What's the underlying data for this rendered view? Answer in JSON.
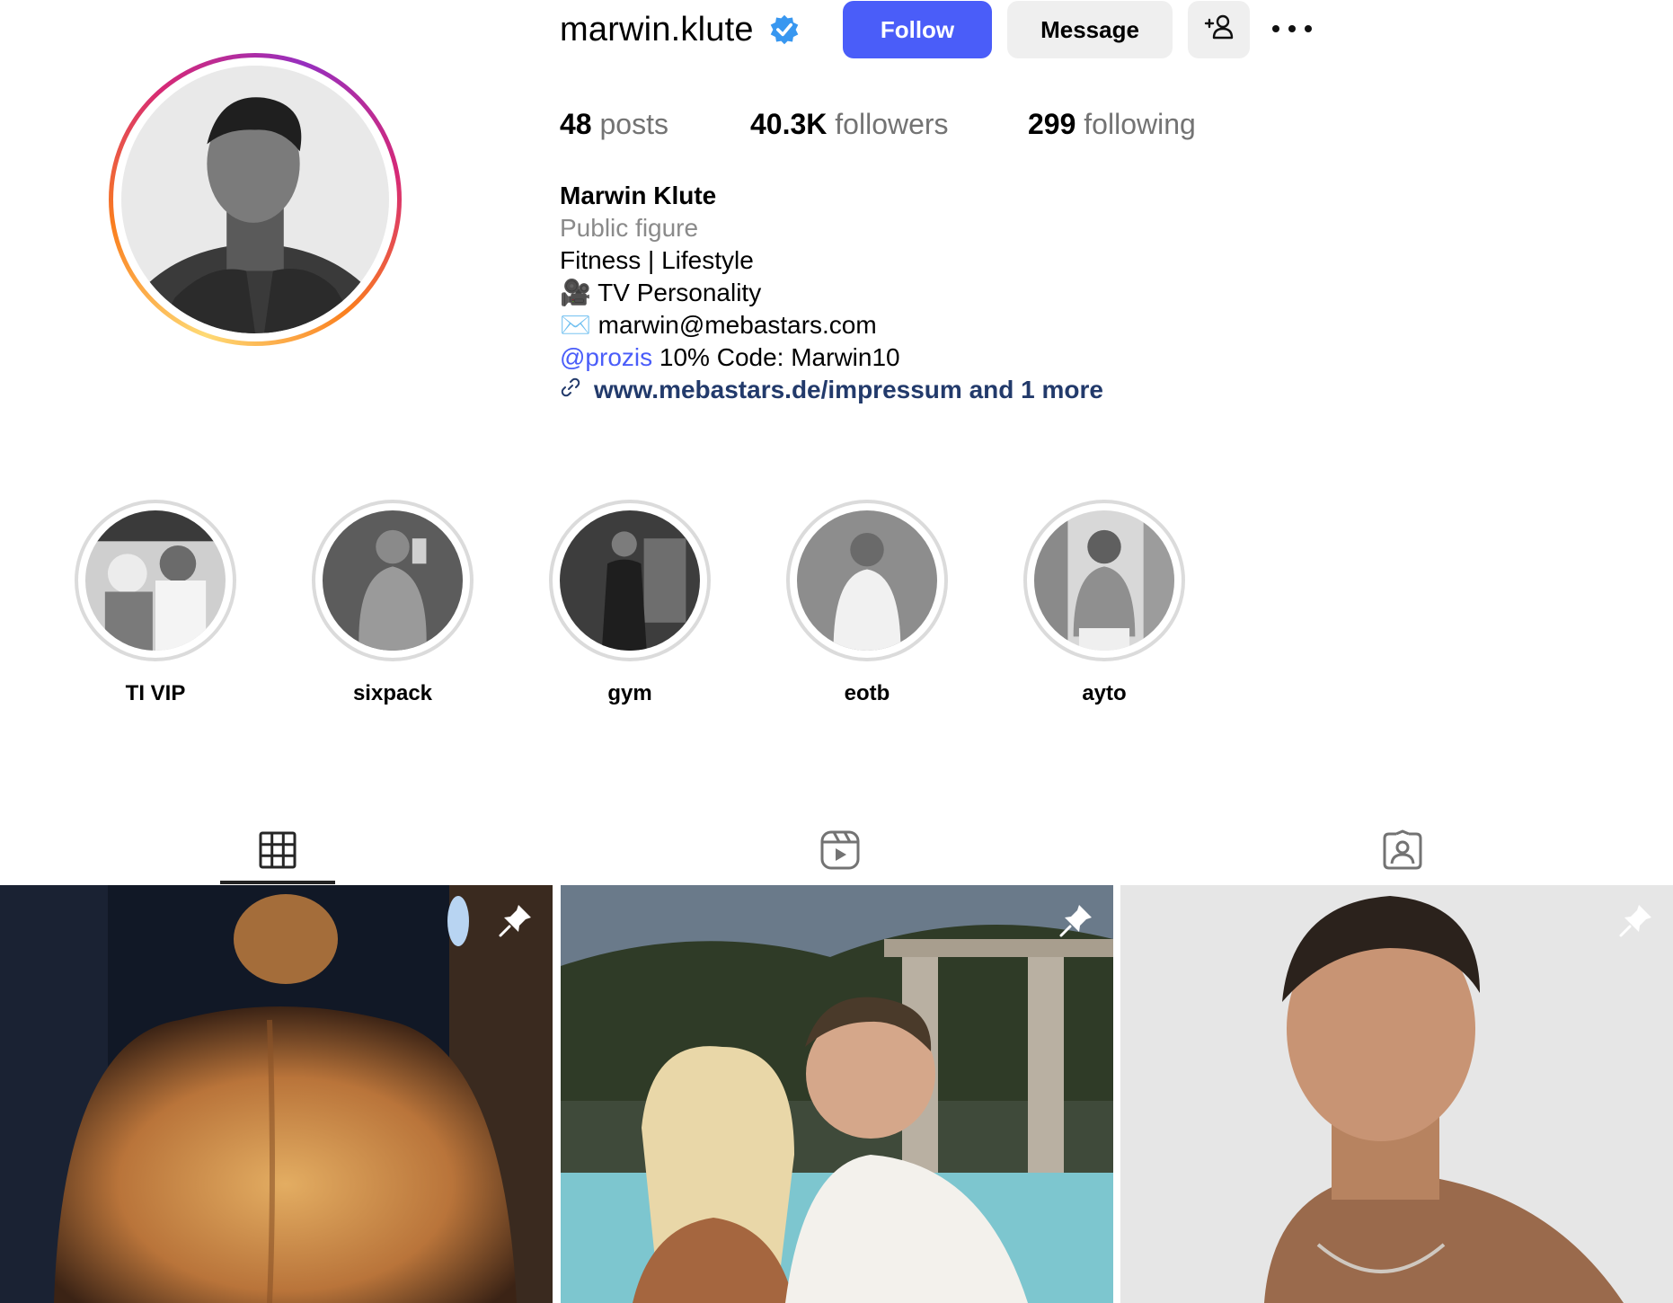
{
  "profile": {
    "username": "marwin.klute",
    "verified": true,
    "follow_label": "Follow",
    "message_label": "Message",
    "suggest_icon": "person-add-icon",
    "more_icon": "more-horizontal-icon"
  },
  "stats": {
    "posts_count": "48",
    "posts_label": "posts",
    "followers_count": "40.3K",
    "followers_label": "followers",
    "following_count": "299",
    "following_label": "following"
  },
  "bio": {
    "full_name": "Marwin Klute",
    "category": "Public figure",
    "line1": "Fitness | Lifestyle",
    "line2": "🎥 TV Personality",
    "line3": "✉️ marwin@mebastars.com",
    "mention": "@prozis",
    "mention_rest": " 10% Code: Marwin10",
    "link": "www.mebastars.de/impressum and 1 more"
  },
  "highlights": [
    {
      "label": "TI VIP"
    },
    {
      "label": "sixpack"
    },
    {
      "label": "gym"
    },
    {
      "label": "eotb"
    },
    {
      "label": "ayto"
    }
  ],
  "tabs": [
    {
      "icon": "grid-icon",
      "active": true
    },
    {
      "icon": "reels-icon",
      "active": false
    },
    {
      "icon": "tagged-icon",
      "active": false
    }
  ],
  "posts": [
    {
      "pinned": true
    },
    {
      "pinned": true
    },
    {
      "pinned": true
    }
  ],
  "colors": {
    "accent": "#4a5df9",
    "link": "#223a6b",
    "muted": "#737373",
    "button_bg": "#efefef"
  }
}
